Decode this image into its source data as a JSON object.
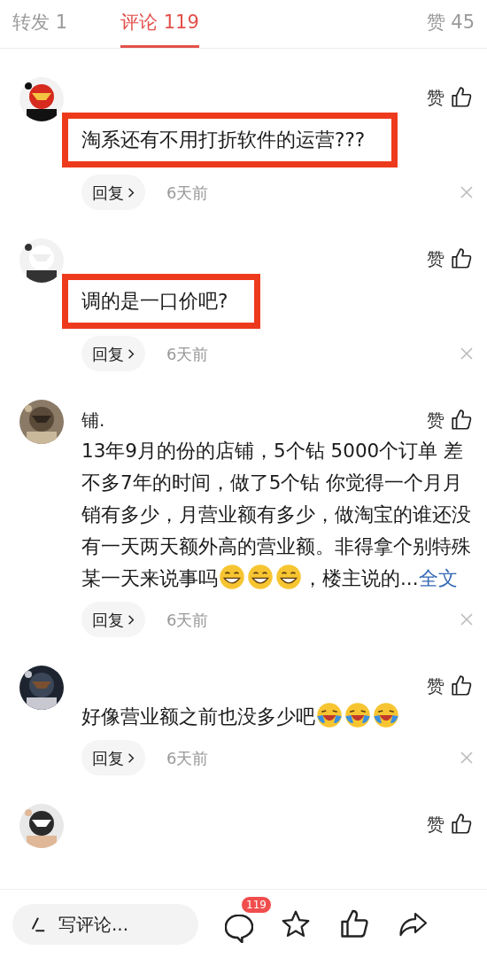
{
  "tabs": [
    {
      "label": "转发 1",
      "selected": false
    },
    {
      "label": "评论 119",
      "selected": true
    },
    {
      "label": "赞 45",
      "selected": false
    }
  ],
  "comments": [
    {
      "like": "赞",
      "highlighted": true,
      "body": [
        {
          "kind": "text",
          "text": "淘系还有不用打折软件的运营???"
        }
      ],
      "reply": "回复",
      "time": "6天前"
    },
    {
      "like": "赞",
      "highlighted": true,
      "body": [
        {
          "kind": "text",
          "text": "调的是一口价吧?"
        }
      ],
      "reply": "回复",
      "time": "6天前"
    },
    {
      "like": "赞",
      "highlighted": false,
      "name": "铺.",
      "body": [
        {
          "kind": "text",
          "text": "13年9月的份的店铺，5个钻 5000个订单 差不多7年的时间，做了5个钻 你觉得一个月月销有多少，月营业额有多少，做淘宝的谁还没有一天两天额外高的营业额。非得拿个别特殊某一天来说事吗"
        },
        {
          "kind": "grin"
        },
        {
          "kind": "grin"
        },
        {
          "kind": "grin"
        },
        {
          "kind": "text",
          "text": "，楼主说的..."
        },
        {
          "kind": "link",
          "text": "全文"
        }
      ],
      "reply": "回复",
      "time": "6天前"
    },
    {
      "like": "赞",
      "highlighted": false,
      "body": [
        {
          "kind": "text",
          "text": "好像营业额之前也没多少吧"
        },
        {
          "kind": "laugh-cry"
        },
        {
          "kind": "laugh-cry"
        },
        {
          "kind": "laugh-cry"
        }
      ],
      "reply": "回复",
      "time": "6天前"
    },
    {
      "like": "赞"
    }
  ],
  "bottom_bar": {
    "placeholder": "写评论...",
    "comment_count": "119"
  }
}
